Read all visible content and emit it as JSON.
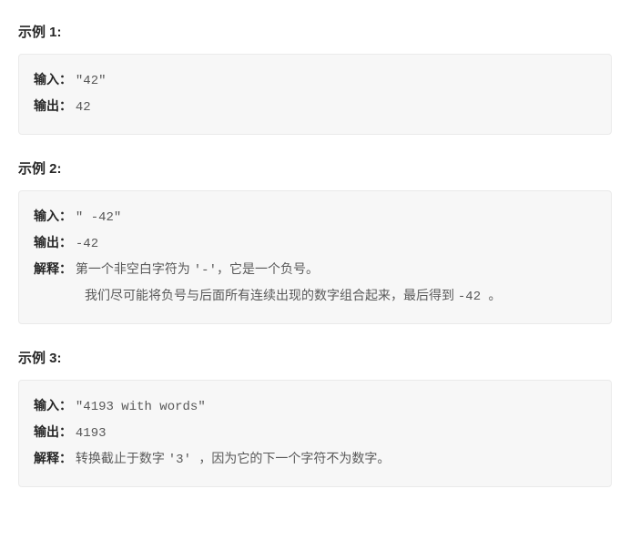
{
  "examples": [
    {
      "title": "示例 1:",
      "input_label": "输入：",
      "input_value": "\"42\"",
      "output_label": "输出：",
      "output_value": "42"
    },
    {
      "title": "示例 2:",
      "input_label": "输入：",
      "input_value": "\"   -42\"",
      "output_label": "输出：",
      "output_value": "-42",
      "explain_label": "解释：",
      "explain_line1_a": "第一个非空白字符为 ",
      "explain_line1_code": "'-'，",
      "explain_line1_b": "它是一个负号。",
      "explain_line2": "我们尽可能将负号与后面所有连续出现的数字组合起来，最后得到 ",
      "explain_line2_code": "-42 ",
      "explain_line2_end": "。"
    },
    {
      "title": "示例 3:",
      "input_label": "输入：",
      "input_value": "\"4193 with words\"",
      "output_label": "输出：",
      "output_value": "4193",
      "explain_label": "解释：",
      "explain_line1_a": "转换截止于数字 ",
      "explain_line1_code": "'3' ",
      "explain_line1_b": "，因为它的下一个字符不为数字。"
    }
  ]
}
